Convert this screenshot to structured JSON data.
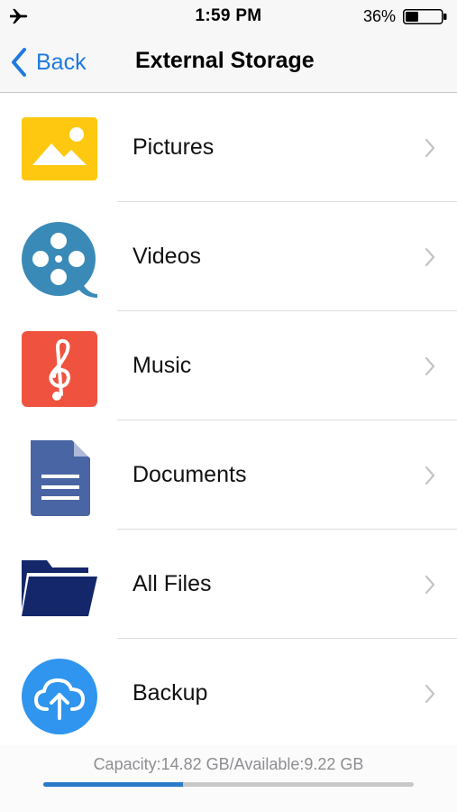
{
  "status_bar": {
    "time": "1:59 PM",
    "battery_percent": "36%",
    "battery_level": 0.36,
    "airplane_icon": "airplane-icon",
    "battery_icon": "battery-icon"
  },
  "nav": {
    "back_label": "Back",
    "title": "External Storage"
  },
  "items": [
    {
      "label": "Pictures",
      "icon": "pictures-icon",
      "color": "#fdc80f"
    },
    {
      "label": "Videos",
      "icon": "videos-icon",
      "color": "#3a8ab8"
    },
    {
      "label": "Music",
      "icon": "music-icon",
      "color": "#ef5340"
    },
    {
      "label": "Documents",
      "icon": "documents-icon",
      "color": "#4a65a4"
    },
    {
      "label": "All Files",
      "icon": "folder-icon",
      "color": "#13276a"
    },
    {
      "label": "Backup",
      "icon": "cloud-upload-icon",
      "color": "#2f95ee"
    }
  ],
  "footer": {
    "capacity_text": "Capacity:14.82 GB/Available:9.22 GB",
    "used_fraction": 0.378
  },
  "colors": {
    "accent": "#1f7ae0",
    "progress": "#2a7ac8"
  }
}
